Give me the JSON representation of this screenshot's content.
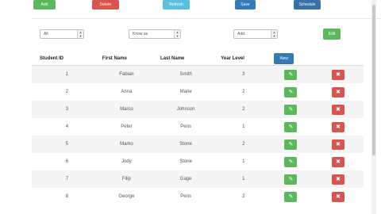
{
  "toolbar": {
    "buttons": [
      {
        "label": "Add"
      },
      {
        "label": "Delete"
      },
      {
        "label": "Refresh"
      },
      {
        "label": "Save"
      },
      {
        "label": "Schedule"
      }
    ]
  },
  "filters": {
    "select1": "All",
    "select2": "Know as",
    "select3": "Add",
    "edit_label": "Edit"
  },
  "table": {
    "headers": [
      "Student ID",
      "First Name",
      "Last Name",
      "Year Level"
    ],
    "add_label": "New",
    "rows": [
      {
        "id": "1",
        "first": "Fabian",
        "last": "Smith",
        "year": "3"
      },
      {
        "id": "2",
        "first": "Anna",
        "last": "Marie",
        "year": "2"
      },
      {
        "id": "3",
        "first": "Marco",
        "last": "Johnson",
        "year": "2"
      },
      {
        "id": "4",
        "first": "Peter",
        "last": "Pens",
        "year": "1"
      },
      {
        "id": "5",
        "first": "Marko",
        "last": "Stone",
        "year": "2"
      },
      {
        "id": "6",
        "first": "Jody",
        "last": "Stone",
        "year": "1"
      },
      {
        "id": "7",
        "first": "Filip",
        "last": "Gage",
        "year": "1"
      },
      {
        "id": "8",
        "first": "George",
        "last": "Pens",
        "year": "2"
      }
    ]
  },
  "icons": {
    "edit": "pencil-icon",
    "delete": "close-icon"
  },
  "colors": {
    "green": "#5cb85c",
    "red": "#d9534f",
    "blue": "#337ab7"
  }
}
